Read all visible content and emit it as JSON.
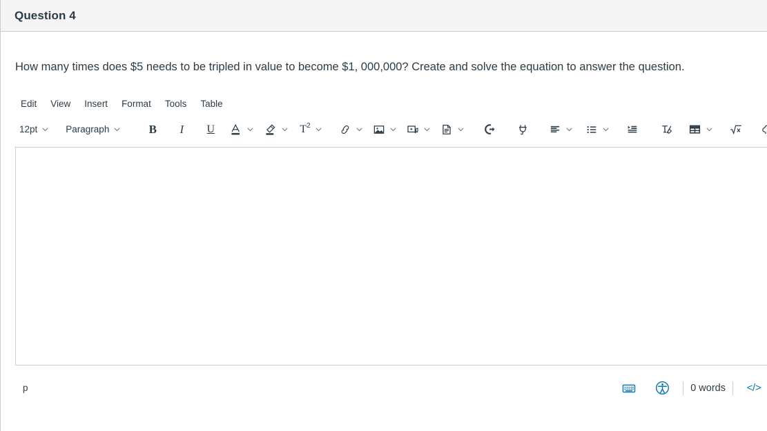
{
  "header": {
    "title": "Question 4"
  },
  "question": {
    "prompt": "How many times does $5 needs to be tripled in value to become $1, 000,000? Create and solve the equation to answer the question."
  },
  "editor": {
    "menubar": [
      {
        "label": "Edit",
        "name": "menu-edit"
      },
      {
        "label": "View",
        "name": "menu-view"
      },
      {
        "label": "Insert",
        "name": "menu-insert"
      },
      {
        "label": "Format",
        "name": "menu-format"
      },
      {
        "label": "Tools",
        "name": "menu-tools"
      },
      {
        "label": "Table",
        "name": "menu-table"
      }
    ],
    "toolbar": {
      "font_size": "12pt",
      "block_format": "Paragraph",
      "bold": "B",
      "italic": "I",
      "underline": "U",
      "text_color_glyph": "A",
      "superscript_glyph": "T",
      "superscript_exponent": "2"
    },
    "content": "",
    "status": {
      "element_path": "p",
      "word_count": "0 words",
      "html_editor_glyph": "</>"
    }
  },
  "colors": {
    "text": "#2d3b45",
    "link": "#0374b5",
    "border": "#c7cdd1",
    "header_bg": "#f5f5f5",
    "icon": "#2d3b45",
    "caret": "#6b7780"
  }
}
